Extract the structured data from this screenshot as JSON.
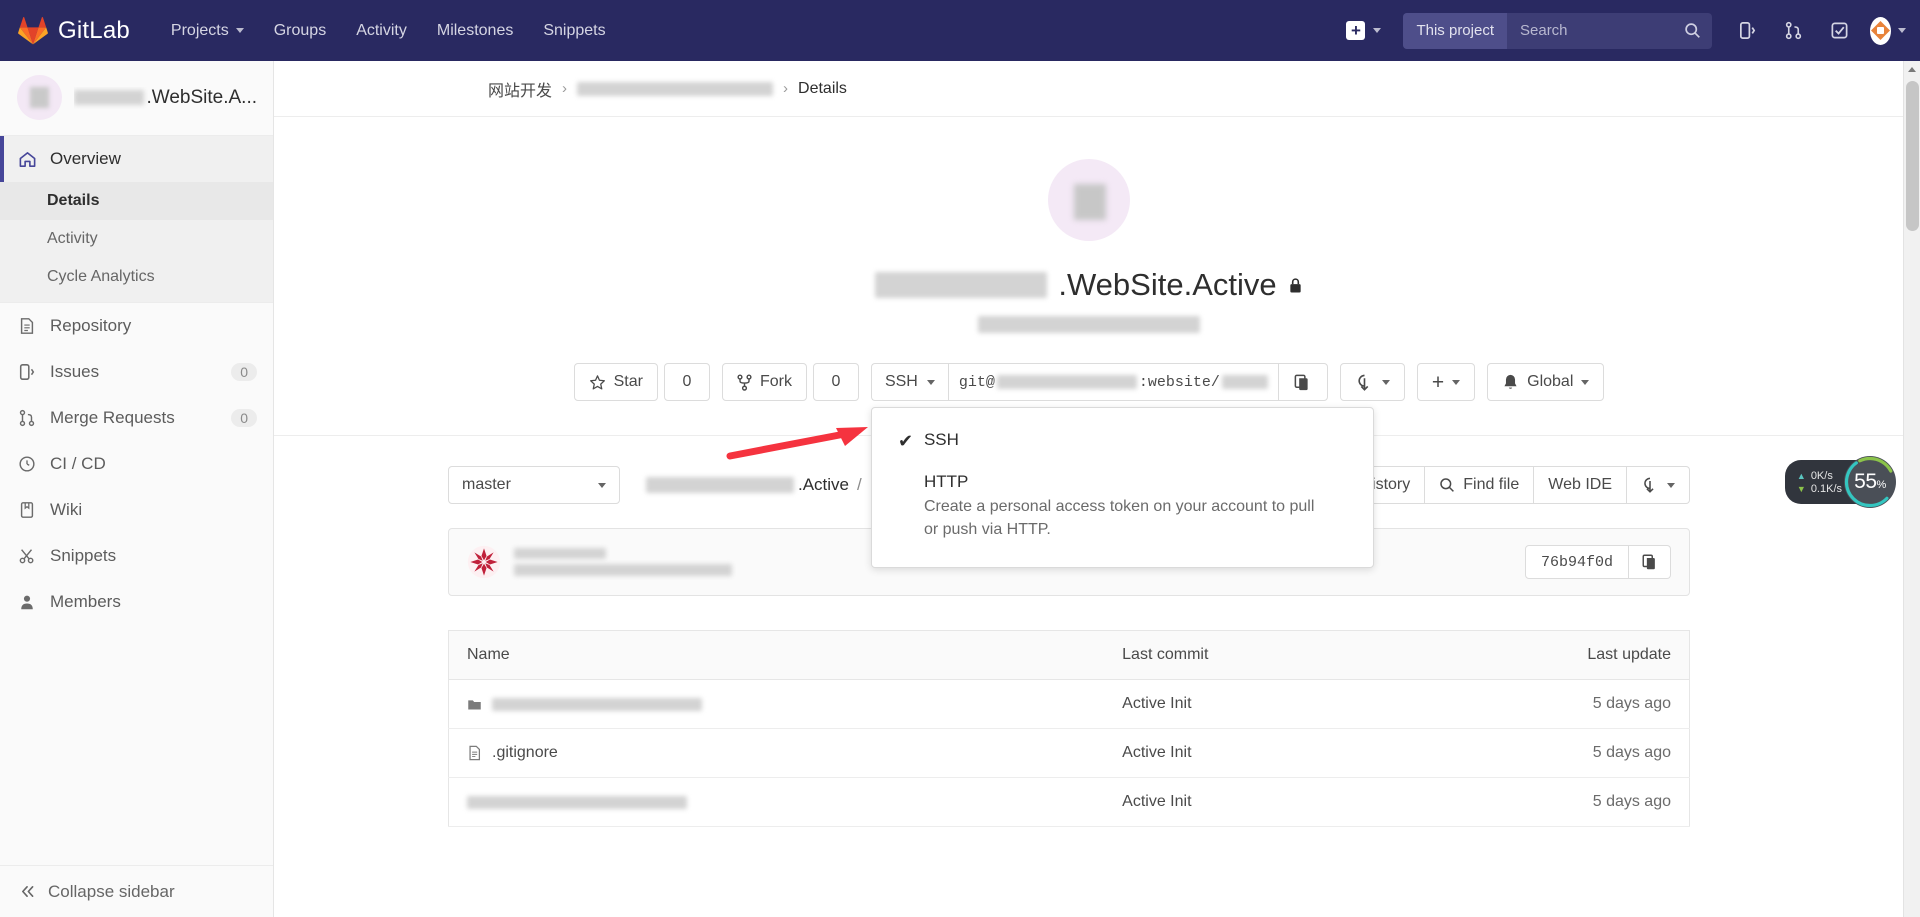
{
  "navbar": {
    "brand": "GitLab",
    "logo_icon": "gitlab-tanuki-logo",
    "links": [
      {
        "label": "Projects",
        "has_caret": true
      },
      {
        "label": "Groups",
        "has_caret": false
      },
      {
        "label": "Activity",
        "has_caret": false
      },
      {
        "label": "Milestones",
        "has_caret": false
      },
      {
        "label": "Snippets",
        "has_caret": false
      }
    ],
    "new_icon": "plus-square-icon",
    "search_scope": "This project",
    "search_placeholder": "Search",
    "search_value": "",
    "search_icon": "search-icon",
    "issues_icon": "issues-icon",
    "merge_requests_icon": "merge-request-icon",
    "todos_icon": "todo-checkbox-icon",
    "user_avatar_icon": "user-avatar"
  },
  "sidebar": {
    "project_name": ".WebSite.A...",
    "project_name_redacted": true,
    "avatar_icon": "project-avatar",
    "groups": [
      {
        "label": "Overview",
        "icon": "home-icon",
        "active": true,
        "sub": [
          {
            "label": "Details",
            "current": true
          },
          {
            "label": "Activity",
            "current": false
          },
          {
            "label": "Cycle Analytics",
            "current": false
          }
        ]
      }
    ],
    "items": [
      {
        "label": "Repository",
        "icon": "document-icon",
        "badge": ""
      },
      {
        "label": "Issues",
        "icon": "issues-icon",
        "badge": "0"
      },
      {
        "label": "Merge Requests",
        "icon": "merge-request-icon",
        "badge": "0"
      },
      {
        "label": "CI / CD",
        "icon": "rocket-icon",
        "badge": ""
      },
      {
        "label": "Wiki",
        "icon": "book-icon",
        "badge": ""
      },
      {
        "label": "Snippets",
        "icon": "scissors-icon",
        "badge": ""
      },
      {
        "label": "Members",
        "icon": "user-icon",
        "badge": ""
      }
    ],
    "collapse_label": "Collapse sidebar",
    "collapse_icon": "chevron-double-left-icon"
  },
  "breadcrumb": {
    "group": "网站开发",
    "project_redacted": true,
    "current": "Details"
  },
  "project": {
    "avatar_icon": "project-avatar-large",
    "title_suffix": ".WebSite.Active",
    "title_redacted": true,
    "visibility_icon": "lock-icon",
    "path_redacted": true
  },
  "actions": {
    "star_label": "Star",
    "star_icon": "star-icon",
    "star_count": "0",
    "fork_label": "Fork",
    "fork_icon": "fork-icon",
    "fork_count": "0",
    "clone_protocol": "SSH",
    "clone_url_prefix": "git@",
    "clone_url_mid": ":website/",
    "copy_icon": "copy-icon",
    "download_icon": "download-icon",
    "add_icon": "plus-icon",
    "notification_label": "Global",
    "notification_icon": "bell-icon"
  },
  "clone_dropdown": {
    "items": [
      {
        "title": "SSH",
        "checked": true,
        "description": ""
      },
      {
        "title": "HTTP",
        "checked": false,
        "description": "Create a personal access token on your account to pull or push via HTTP."
      }
    ]
  },
  "repo_toolbar": {
    "branch": "master",
    "path_suffix": ".Active",
    "path_separator": "/",
    "add_icon": "plus-icon",
    "history_label": "History",
    "find_file_label": "Find file",
    "find_file_icon": "search-icon",
    "web_ide_label": "Web IDE",
    "download_icon": "download-icon"
  },
  "commit": {
    "author_avatar_icon": "commit-author-avatar",
    "message_redacted": true,
    "sha": "76b94f0d",
    "copy_icon": "copy-icon"
  },
  "files": {
    "columns": [
      "Name",
      "Last commit",
      "Last update"
    ],
    "rows": [
      {
        "name": "",
        "name_redacted": true,
        "icon": "folder-icon",
        "last_commit": "Active Init",
        "last_update": "5 days ago"
      },
      {
        "name": ".gitignore",
        "name_redacted": false,
        "icon": "file-icon",
        "last_commit": "Active Init",
        "last_update": "5 days ago"
      },
      {
        "name": "",
        "name_redacted": true,
        "icon": "file-icon",
        "last_commit": "Active Init",
        "last_update": "5 days ago"
      }
    ]
  },
  "net_widget": {
    "upload": "0K/s",
    "download": "0.1K/s",
    "up_icon": "arrow-up-icon",
    "down_icon": "arrow-down-icon",
    "percent": "55",
    "percent_unit": "%"
  },
  "colors": {
    "navbar_bg": "#292961",
    "accent": "#464699",
    "annotation_red": "#f5333f",
    "gauge_green": "#8bc34a",
    "gauge_teal": "#34c6c0"
  }
}
